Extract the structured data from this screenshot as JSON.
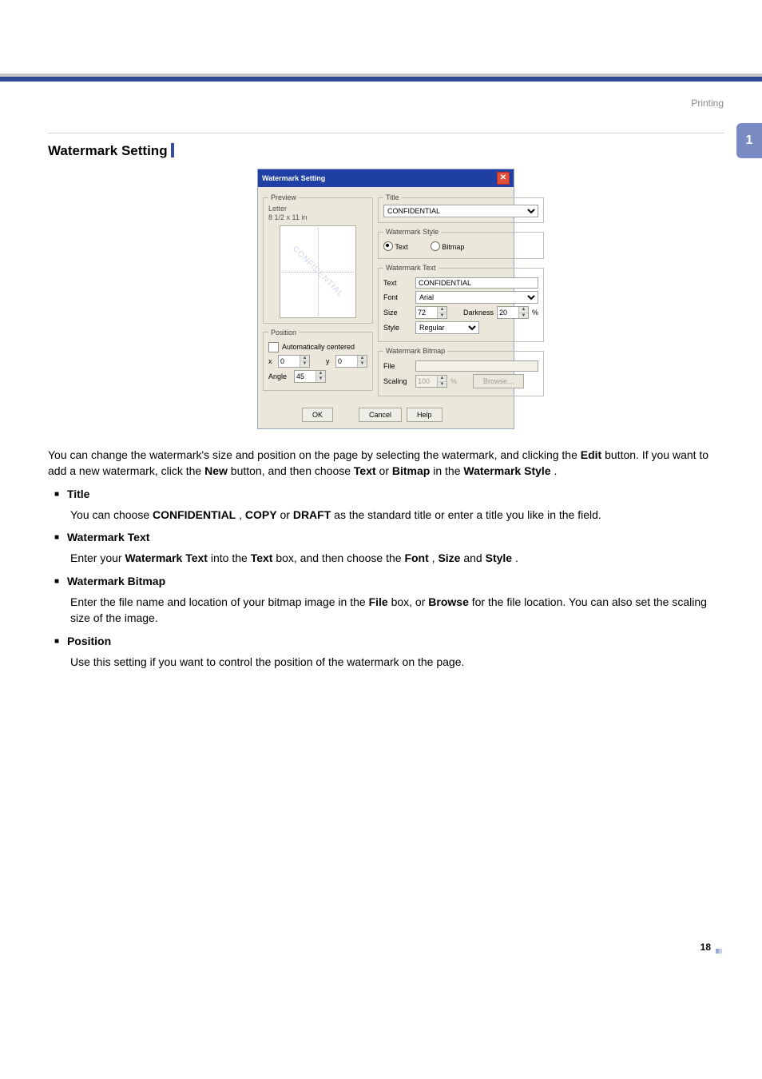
{
  "header": {
    "section": "Printing"
  },
  "chapter": {
    "number": "1"
  },
  "footer": {
    "page": "18"
  },
  "section": {
    "title": "Watermark Setting"
  },
  "dialog": {
    "title": "Watermark Setting",
    "preview": {
      "legend": "Preview",
      "paper": "Letter",
      "dims": "8 1/2 x 11 in",
      "wm_text": "CONFIDENTIAL"
    },
    "titlegrp": {
      "legend": "Title",
      "value": "CONFIDENTIAL"
    },
    "stylegrp": {
      "legend": "Watermark Style",
      "text": "Text",
      "bitmap": "Bitmap"
    },
    "textgrp": {
      "legend": "Watermark Text",
      "text_label": "Text",
      "text_value": "CONFIDENTIAL",
      "font_label": "Font",
      "font_value": "Arial",
      "size_label": "Size",
      "size_value": "72",
      "darkness_label": "Darkness",
      "darkness_value": "20",
      "darkness_unit": "%",
      "style_label": "Style",
      "style_value": "Regular"
    },
    "position": {
      "legend": "Position",
      "auto_label": "Automatically centered",
      "x_label": "x",
      "x_value": "0",
      "y_label": "y",
      "y_value": "0",
      "angle_label": "Angle",
      "angle_value": "45"
    },
    "bitmapgrp": {
      "legend": "Watermark Bitmap",
      "file_label": "File",
      "scaling_label": "Scaling",
      "scaling_value": "100",
      "scaling_unit": "%",
      "browse": "Browse..."
    },
    "buttons": {
      "ok": "OK",
      "cancel": "Cancel",
      "help": "Help"
    }
  },
  "copy": {
    "intro_a": "You can change the watermark's size and position on the page by selecting the watermark, and clicking the ",
    "intro_edit": "Edit",
    "intro_b": " button. If you want to add a new watermark, click the ",
    "intro_new": "New",
    "intro_c": " button, and then choose ",
    "intro_text": "Text",
    "intro_or": " or ",
    "intro_bitmap": "Bitmap",
    "intro_d": " in the ",
    "intro_ws": "Watermark Style",
    "intro_e": ".",
    "b_title": "Title",
    "title_a": "You can choose ",
    "title_conf": "CONFIDENTIAL",
    "title_sep1": ", ",
    "title_copy": "COPY",
    "title_sep2": " or ",
    "title_draft": "DRAFT",
    "title_b": " as the standard title or enter a title you like in the field.",
    "b_wt": "Watermark Text",
    "wt_a": "Enter your ",
    "wt_wt": "Watermark Text",
    "wt_b": " into the ",
    "wt_text": "Text",
    "wt_c": " box, and then choose the ",
    "wt_font": "Font",
    "wt_d": ", ",
    "wt_size": "Size",
    "wt_e": " and ",
    "wt_style": "Style",
    "wt_f": ".",
    "b_wb": "Watermark Bitmap",
    "wb_a": "Enter the file name and location of your bitmap image in the ",
    "wb_file": "File",
    "wb_b": " box, or ",
    "wb_browse": "Browse",
    "wb_c": " for the file location. You can also set the scaling size of the image.",
    "b_pos": "Position",
    "pos_a": "Use this setting if you want to control the position of the watermark on the page."
  }
}
